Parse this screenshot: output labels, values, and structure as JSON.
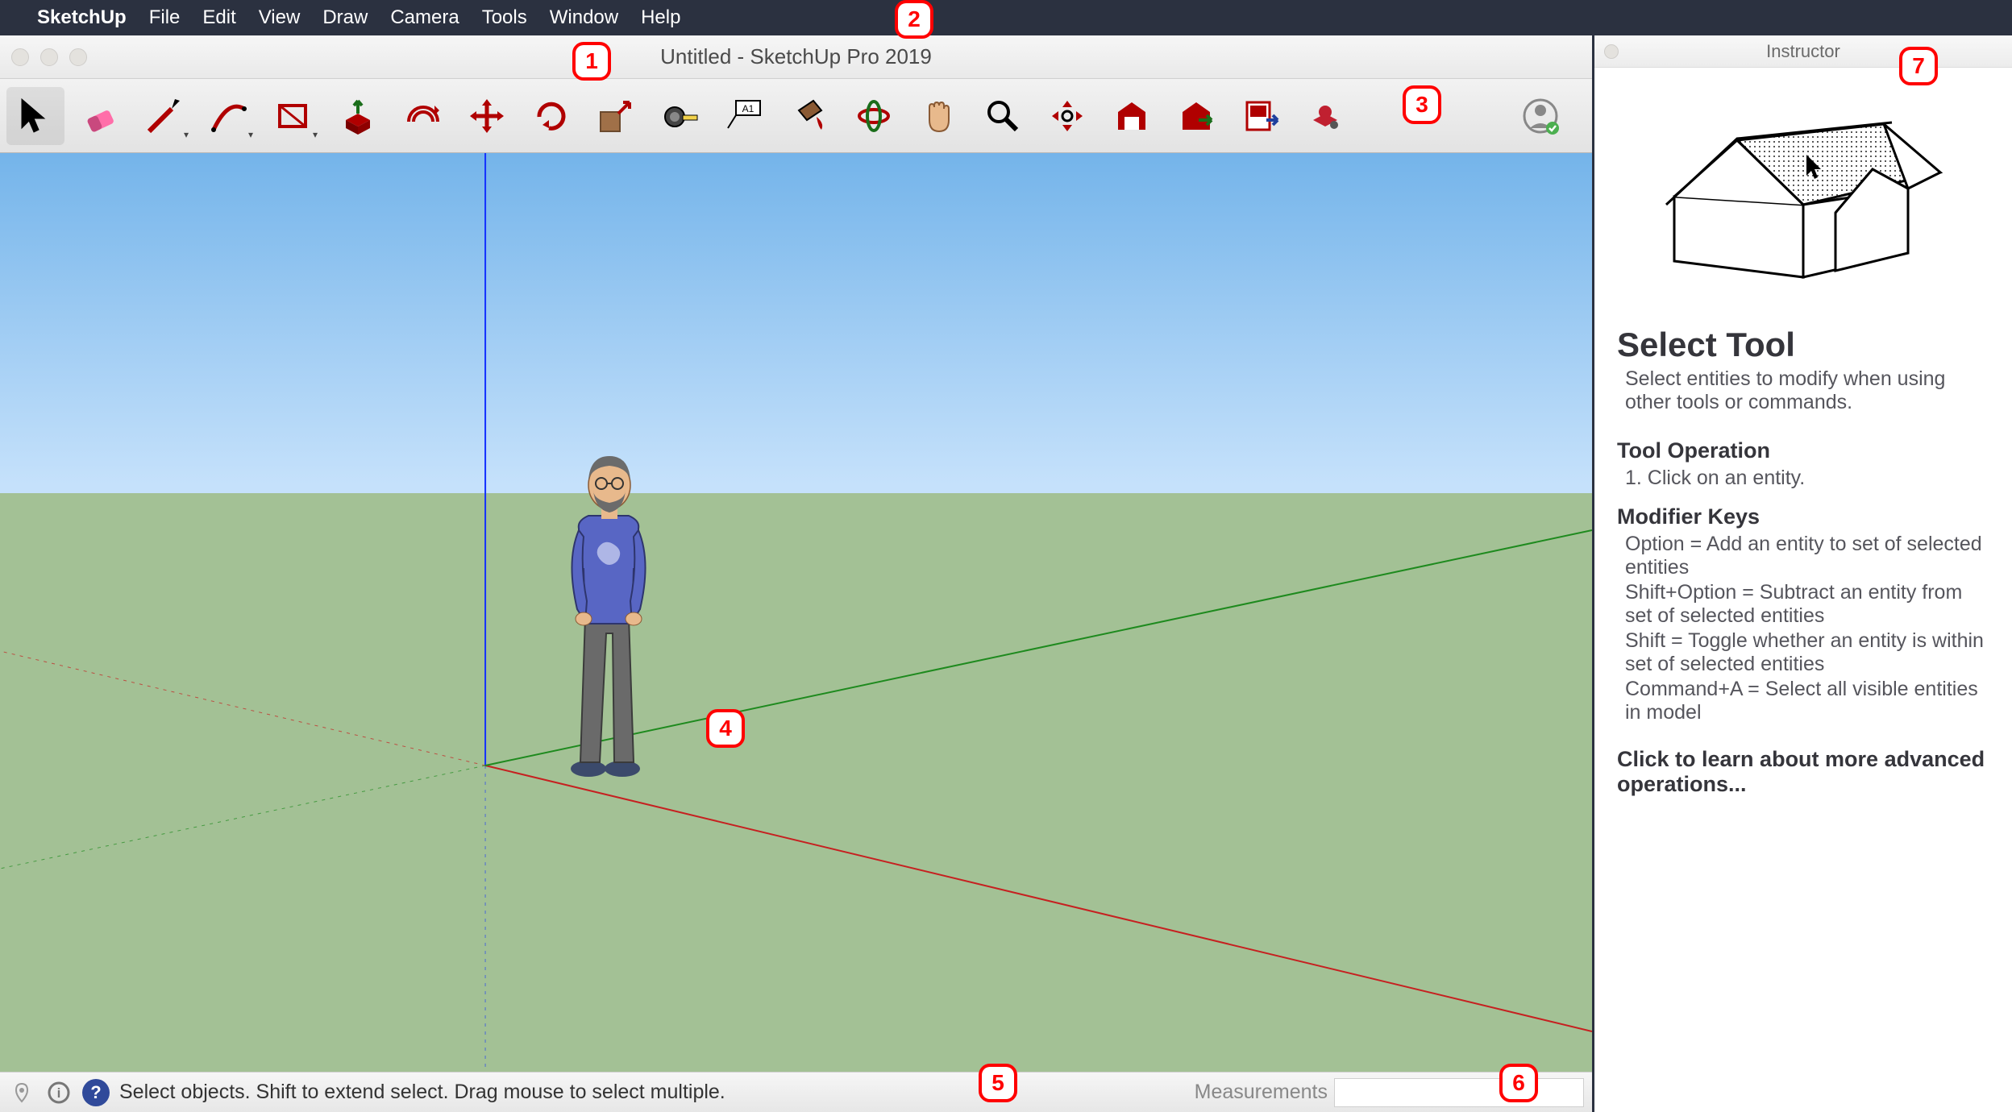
{
  "menubar": {
    "apple": "",
    "appname": "SketchUp",
    "items": [
      "File",
      "Edit",
      "View",
      "Draw",
      "Camera",
      "Tools",
      "Window",
      "Help"
    ]
  },
  "window": {
    "title": "Untitled - SketchUp Pro 2019"
  },
  "toolbar": {
    "tools": [
      {
        "id": "select",
        "name": "select-tool-icon",
        "active": true
      },
      {
        "id": "eraser",
        "name": "eraser-tool-icon"
      },
      {
        "id": "line",
        "name": "line-tool-icon",
        "dropdown": true
      },
      {
        "id": "arc",
        "name": "arc-tool-icon",
        "dropdown": true
      },
      {
        "id": "shape",
        "name": "rectangle-tool-icon",
        "dropdown": true
      },
      {
        "id": "pushpull",
        "name": "push-pull-tool-icon"
      },
      {
        "id": "offset",
        "name": "offset-tool-icon"
      },
      {
        "id": "move",
        "name": "move-tool-icon"
      },
      {
        "id": "rotate",
        "name": "rotate-tool-icon"
      },
      {
        "id": "scale",
        "name": "scale-tool-icon"
      },
      {
        "id": "tape",
        "name": "tape-measure-tool-icon"
      },
      {
        "id": "text",
        "name": "text-tool-icon"
      },
      {
        "id": "paint",
        "name": "paint-bucket-tool-icon"
      },
      {
        "id": "orbit",
        "name": "orbit-tool-icon"
      },
      {
        "id": "pan",
        "name": "pan-tool-icon"
      },
      {
        "id": "zoom",
        "name": "zoom-tool-icon"
      },
      {
        "id": "zoomext",
        "name": "zoom-extents-tool-icon"
      },
      {
        "id": "warehouse",
        "name": "3d-warehouse-icon"
      },
      {
        "id": "whshare",
        "name": "share-model-icon"
      },
      {
        "id": "layout",
        "name": "layout-icon"
      },
      {
        "id": "ext",
        "name": "extension-warehouse-icon"
      }
    ]
  },
  "statusbar": {
    "hint": "Select objects. Shift to extend select. Drag mouse to select multiple.",
    "measurements_label": "Measurements",
    "measurements_value": ""
  },
  "instructor": {
    "panel_title": "Instructor",
    "title": "Select Tool",
    "subtitle": "Select entities to modify when using other tools or commands.",
    "operation_heading": "Tool Operation",
    "operation_step": "1. Click on an entity.",
    "modifiers_heading": "Modifier Keys",
    "modifiers": [
      "Option = Add an entity to set of selected entities",
      "Shift+Option = Subtract an entity from set of selected entities",
      "Shift = Toggle whether an entity is within set of selected entities",
      "Command+A = Select all visible entities in model"
    ],
    "learn_more": "Click to learn about more advanced operations..."
  },
  "callouts": [
    "1",
    "2",
    "3",
    "4",
    "5",
    "6",
    "7"
  ]
}
